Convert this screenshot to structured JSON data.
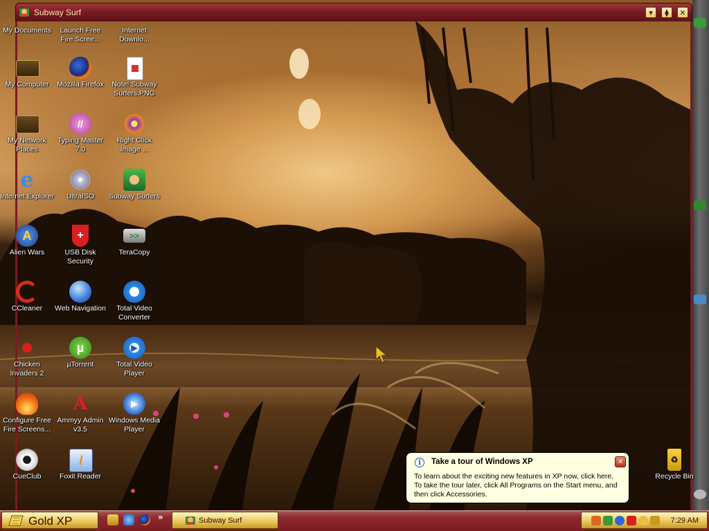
{
  "window": {
    "title": "Subway Surf",
    "controls": [
      "minimize",
      "restore",
      "close"
    ],
    "minimize_glyph": "▾",
    "restore_glyph": "⧫",
    "close_glyph": "✕"
  },
  "desktop_icons": [
    {
      "label": "My Documents",
      "icon": "folder-documents-icon"
    },
    {
      "label": "Launch Free Fire Scree...",
      "icon": "launch-firescreen-icon"
    },
    {
      "label": "Internet Downlo...",
      "icon": "internet-download-icon"
    },
    {
      "label": "My Computer",
      "icon": "computer-icon"
    },
    {
      "label": "Mozilla Firefox",
      "icon": "firefox-icon"
    },
    {
      "label": "Note! Subway Surfers.PNG",
      "icon": "png-file-icon"
    },
    {
      "label": "My Network Places",
      "icon": "network-places-icon"
    },
    {
      "label": "Typing Master 7.0",
      "icon": "typing-master-icon"
    },
    {
      "label": "Right Click Image ...",
      "icon": "right-click-image-icon"
    },
    {
      "label": "Internet Explorer",
      "icon": "internet-explorer-icon"
    },
    {
      "label": "UltraISO",
      "icon": "ultraiso-disc-icon"
    },
    {
      "label": "Subway Surfers",
      "icon": "subway-surfers-icon"
    },
    {
      "label": "Alien Wars",
      "icon": "alien-wars-icon"
    },
    {
      "label": "USB Disk Security",
      "icon": "usb-disk-security-shield-icon"
    },
    {
      "label": "TeraCopy",
      "icon": "teracopy-icon"
    },
    {
      "label": "CCleaner",
      "icon": "ccleaner-icon"
    },
    {
      "label": "Web Navigation",
      "icon": "web-navigation-globe-icon"
    },
    {
      "label": "Total Video Converter",
      "icon": "total-video-converter-icon"
    },
    {
      "label": "Chicken Invaders 2",
      "icon": "chicken-invaders-icon"
    },
    {
      "label": "µTorrent",
      "icon": "utorrent-icon"
    },
    {
      "label": "Total Video Player",
      "icon": "total-video-player-icon"
    },
    {
      "label": "Configure Free Fire Screens...",
      "icon": "configure-firescreen-icon"
    },
    {
      "label": "Ammyy Admin v3.5",
      "icon": "ammyy-admin-icon"
    },
    {
      "label": "Windows Media Player",
      "icon": "windows-media-player-icon"
    },
    {
      "label": "CueClub",
      "icon": "cueclub-icon"
    },
    {
      "label": "Foxit Reader",
      "icon": "foxit-reader-icon"
    },
    {
      "label": "Recycle Bin",
      "icon": "recycle-bin-icon"
    }
  ],
  "balloon": {
    "title": "Take a tour of Windows XP",
    "body": "To learn about the exciting new features in XP now, click here. To take the tour later, click All Programs on the Start menu, and then click Accessories.",
    "close_glyph": "✕",
    "info_glyph": "i"
  },
  "taskbar": {
    "start_label": "Gold XP",
    "quick_launch": [
      "show-desktop-icon",
      "internet-explorer-icon",
      "firefox-icon"
    ],
    "overflow_glyph": "»",
    "task_label": "Subway Surf",
    "clock": "7:29 AM"
  },
  "colors": {
    "title_bar": "#7a1b22",
    "taskbar": "#8e2a30",
    "start_button": "#e8c456",
    "balloon_bg": "#ffffe1"
  }
}
